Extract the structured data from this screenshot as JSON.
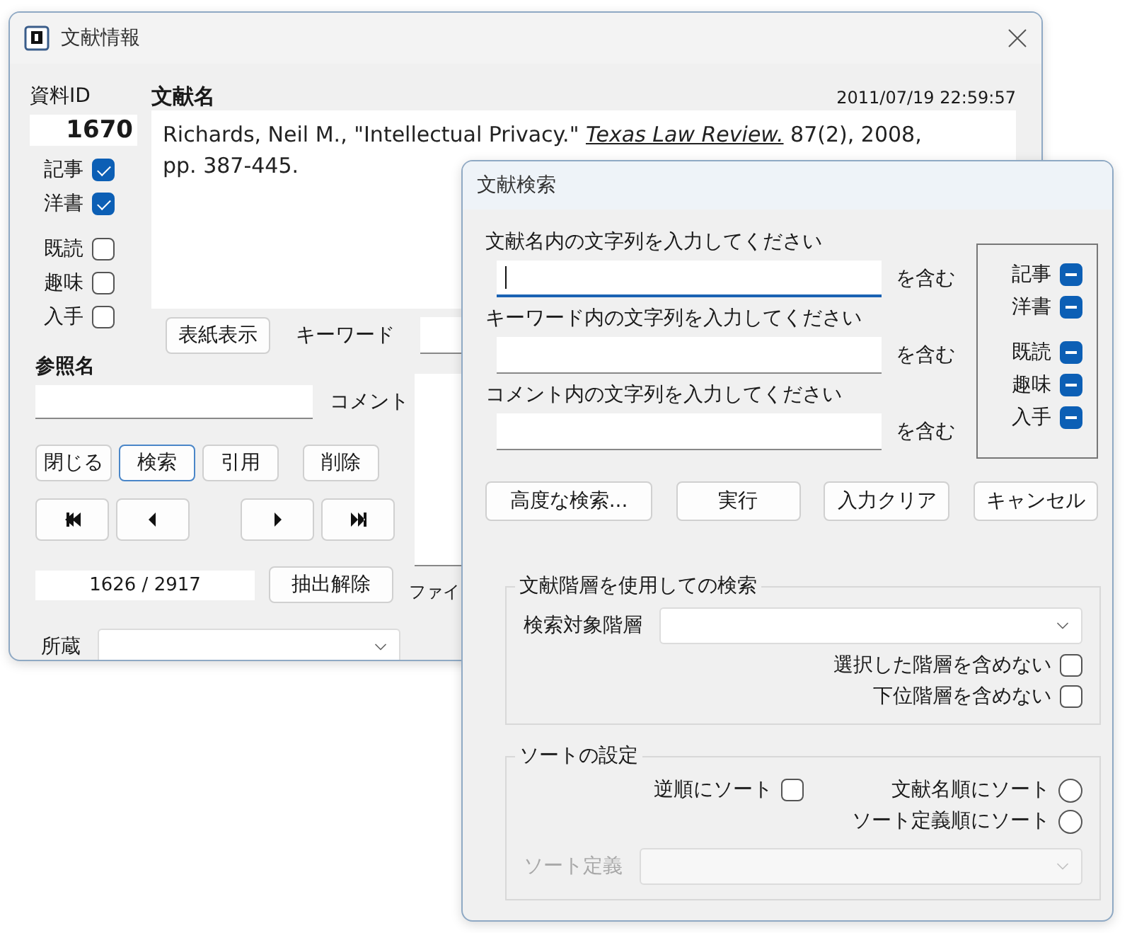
{
  "info_window": {
    "title": "文献情報",
    "id_label": "資料ID",
    "id_value": "1670",
    "name_label": "文献名",
    "timestamp": "2011/07/19 22:59:57",
    "citation": "Richards, Neil M., \"Intellectual Privacy.\" *Texas Law Review.* 87(2), 2008,\npp. 387-445.",
    "flag_groups": [
      {
        "items": [
          {
            "label": "記事",
            "checked": true
          },
          {
            "label": "洋書",
            "checked": true
          }
        ]
      },
      {
        "items": [
          {
            "label": "既読",
            "checked": false
          },
          {
            "label": "趣味",
            "checked": false
          },
          {
            "label": "入手",
            "checked": false
          }
        ]
      }
    ],
    "cover_button": "表紙表示",
    "keyword_label": "キーワード",
    "reference_label": "参照名",
    "comment_label": "コメント",
    "file_label": "ファイ",
    "buttons": [
      {
        "label": "閉じる",
        "focused": false
      },
      {
        "label": "検索",
        "focused": true
      },
      {
        "label": "引用",
        "focused": false
      },
      {
        "label": "削除",
        "focused": false
      }
    ],
    "record_count": "1626 / 2917",
    "extract_clear_button": "抽出解除",
    "holding_label": "所蔵"
  },
  "search_dialog": {
    "title": "文献検索",
    "fields": [
      {
        "label": "文献名内の文字列を入力してください",
        "suffix": "を含む",
        "focused": true
      },
      {
        "label": "キーワード内の文字列を入力してください",
        "suffix": "を含む",
        "focused": false
      },
      {
        "label": "コメント内の文字列を入力してください",
        "suffix": "を含む",
        "focused": false
      }
    ],
    "filter_groups": [
      {
        "items": [
          {
            "label": "記事",
            "indeterminate": true
          },
          {
            "label": "洋書",
            "indeterminate": true
          }
        ]
      },
      {
        "items": [
          {
            "label": "既読",
            "indeterminate": true
          },
          {
            "label": "趣味",
            "indeterminate": true
          },
          {
            "label": "入手",
            "indeterminate": true
          }
        ]
      }
    ],
    "buttons": [
      "高度な検索...",
      "実行",
      "入力クリア",
      "キャンセル"
    ],
    "hierarchy": {
      "legend": "文献階層を使用しての検索",
      "target_label": "検索対象階層",
      "options": [
        {
          "label": "選択した階層を含めない",
          "checked": false
        },
        {
          "label": "下位階層を含めない",
          "checked": false
        }
      ]
    },
    "sort": {
      "legend": "ソートの設定",
      "reverse": {
        "label": "逆順にソート",
        "checked": false
      },
      "orders": [
        {
          "label": "文献名順にソート",
          "selected": false
        },
        {
          "label": "ソート定義順にソート",
          "selected": false
        }
      ],
      "definition_label": "ソート定義",
      "definition_disabled": true
    }
  }
}
